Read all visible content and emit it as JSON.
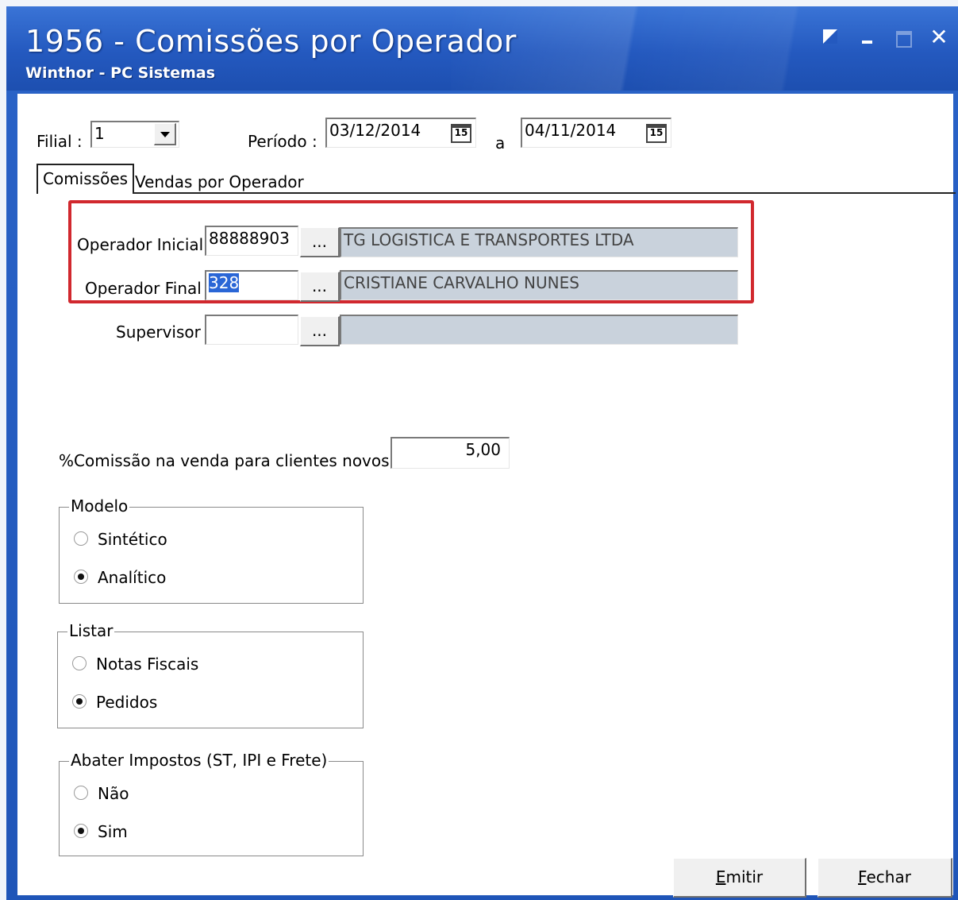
{
  "window": {
    "title": "1956 - Comissões por Operador",
    "subtitle": "Winthor - PC Sistemas",
    "controls": {
      "close": "✕"
    }
  },
  "filters": {
    "filial_label": "Filial :",
    "filial_value": "1",
    "periodo_label": "Período :",
    "date_start": "03/12/2014",
    "date_sep": "a",
    "date_end": "04/11/2014",
    "calendar_glyph": "15"
  },
  "tabs": [
    {
      "label": "Comissões",
      "active": true
    },
    {
      "label": "Vendas por Operador",
      "active": false
    }
  ],
  "operators": {
    "inicial": {
      "label": "Operador Inicial",
      "code": "88888903",
      "name": "TG LOGISTICA E TRANSPORTES LTDA"
    },
    "final": {
      "label": "Operador Final",
      "code": "328",
      "name": "CRISTIANE CARVALHO NUNES"
    },
    "supervisor": {
      "label": "Supervisor",
      "code": "",
      "name": ""
    },
    "lookup_label": "..."
  },
  "commission": {
    "label": "%Comissão na venda para clientes novos",
    "value": "5,00"
  },
  "groups": {
    "modelo": {
      "title": "Modelo",
      "options": [
        "Sintético",
        "Analítico"
      ],
      "selected": "Analítico"
    },
    "listar": {
      "title": "Listar",
      "options": [
        "Notas Fiscais",
        "Pedidos"
      ],
      "selected": "Pedidos"
    },
    "abater": {
      "title": "Abater Impostos (ST, IPI e Frete)",
      "options": [
        "Não",
        "Sim"
      ],
      "selected": "Sim"
    }
  },
  "buttons": {
    "emitir": {
      "accel": "E",
      "rest": "mitir"
    },
    "fechar": {
      "accel": "F",
      "rest": "echar"
    }
  },
  "colors": {
    "titlebar": "#2459bf",
    "highlight_border": "#d1282e",
    "readonly_field": "#c9d2dc",
    "selection": "#2a66d6"
  }
}
